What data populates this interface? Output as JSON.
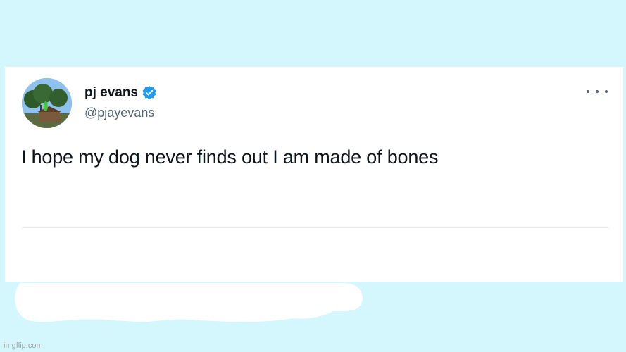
{
  "tweet": {
    "display_name": "pj evans",
    "handle": "@pjayevans",
    "text": "I hope my dog never finds out I am made of bones",
    "verified": true,
    "accent_color": "#1d9bf0"
  },
  "icons": [
    "avatar",
    "verified-badge-icon",
    "more-options-icon"
  ],
  "watermark": "imgflip.com",
  "colors": {
    "background": "#d4f6fd",
    "card": "#ffffff",
    "text": "#0f1419",
    "muted": "#536471"
  }
}
